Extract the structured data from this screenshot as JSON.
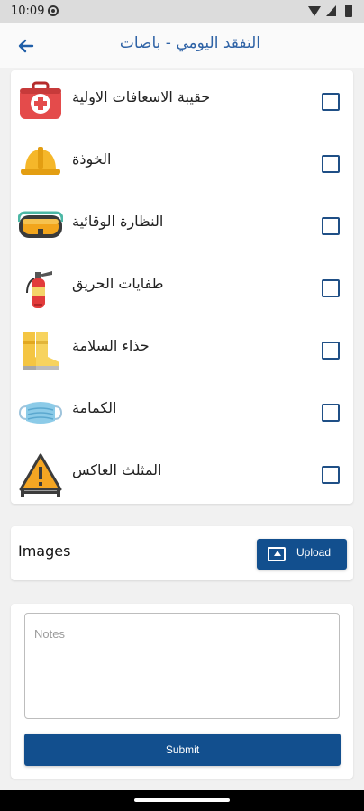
{
  "status_bar": {
    "time": "10:09"
  },
  "app_bar": {
    "back_icon": "arrow-back-icon",
    "title": "التفقد اليومي - باصات"
  },
  "checklist": [
    {
      "label": "حقيبة الاسعافات الاولية",
      "icon": "first-aid-kit-icon",
      "checked": false
    },
    {
      "label": "الخوذة",
      "icon": "hard-hat-icon",
      "checked": false
    },
    {
      "label": "النظارة الوقائية",
      "icon": "safety-goggles-icon",
      "checked": false
    },
    {
      "label": "طفايات الحريق",
      "icon": "fire-extinguisher-icon",
      "checked": false
    },
    {
      "label": "حذاء السلامة",
      "icon": "safety-boots-icon",
      "checked": false
    },
    {
      "label": "الكمامة",
      "icon": "face-mask-icon",
      "checked": false
    },
    {
      "label": "المثلث العاكس",
      "icon": "warning-triangle-icon",
      "checked": false
    }
  ],
  "images_section": {
    "label": "Images",
    "upload_label": "Upload",
    "upload_icon": "upload-icon"
  },
  "notes_section": {
    "placeholder": "Notes",
    "submit_label": "Submit"
  },
  "colors": {
    "primary": "#124f8e",
    "title": "#2f63a6",
    "background": "#f1f1f1"
  }
}
